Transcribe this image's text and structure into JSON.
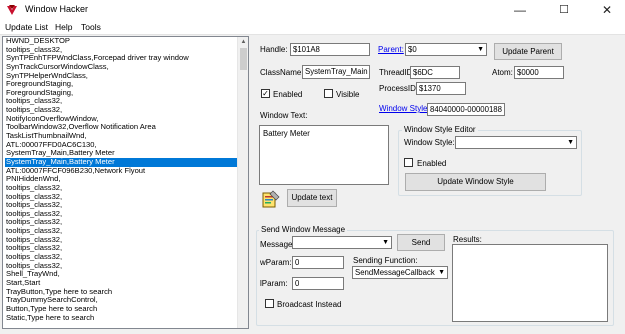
{
  "window": {
    "title": "Window Hacker",
    "minimize": "—",
    "maximize": "☐",
    "close": "✕"
  },
  "menu": {
    "items": [
      "Update List",
      "Help",
      "Tools"
    ]
  },
  "window_list": {
    "selected_index": 14,
    "items": [
      "HWND_DESKTOP",
      "tooltips_class32,",
      "SynTPEnhTFPWndClass,Forcepad driver tray window",
      "SynTrackCursorWindowClass,",
      "SynTPHelperWndClass,",
      "ForegroundStaging,",
      "ForegroundStaging,",
      "tooltips_class32,",
      "tooltips_class32,",
      "NotifyIconOverflowWindow,",
      "ToolbarWindow32,Overflow Notification Area",
      "TaskListThumbnailWnd,",
      "ATL:00007FFD0AC6C130,",
      "SystemTray_Main,Battery Meter",
      "SystemTray_Main,Battery Meter",
      "ATL:00007FFCF096B230,Network Flyout",
      "PNIHiddenWnd,",
      "tooltips_class32,",
      "tooltips_class32,",
      "tooltips_class32,",
      "tooltips_class32,",
      "tooltips_class32,",
      "tooltips_class32,",
      "tooltips_class32,",
      "tooltips_class32,",
      "tooltips_class32,",
      "tooltips_class32,",
      "Shell_TrayWnd,",
      "Start,Start",
      "TrayButton,Type here to search",
      "TrayDummySearchControl,",
      "Button,Type here to search",
      "Static,Type here to search"
    ]
  },
  "props": {
    "handle_label": "Handle:",
    "handle_value": "$101A8",
    "parent_label": "Parent:",
    "parent_value": "$0",
    "update_parent": "Update Parent",
    "classname_label": "ClassName:",
    "classname_value": "SystemTray_Main",
    "threadid_label": "ThreadID:",
    "threadid_value": "$6DC",
    "atom_label": "Atom:",
    "atom_value": "$0000",
    "processid_label": "ProcessID:",
    "processid_value": "$1370",
    "enabled_label": "Enabled",
    "visible_label": "Visible",
    "windowtext_label": "Window Text:",
    "windowtext_value": "Battery Meter",
    "windowstyle_label": "Window Style:",
    "windowstyle_value": "84040000-00000188",
    "update_text": "Update text"
  },
  "style_editor": {
    "title": "Window Style Editor",
    "style_label": "Window Style:",
    "style_value": "",
    "enabled_label": "Enabled",
    "update_button": "Update Window Style"
  },
  "send_message": {
    "title": "Send Window Message",
    "message_label": "Message",
    "message_value": "",
    "send_button": "Send",
    "results_label": "Results:",
    "wparam_label": "wParam:",
    "wparam_value": "0",
    "lparam_label": "lParam:",
    "lparam_value": "0",
    "sending_function_label": "Sending Function:",
    "sending_function_value": "SendMessageCallback",
    "broadcast_label": "Broadcast Instead"
  },
  "state": {
    "enabled_checked": true,
    "visible_checked": false,
    "editor_enabled_checked": false,
    "broadcast_checked": false
  },
  "colors": {
    "selection": "#0078d7",
    "link": "#0000ee",
    "default_button_border": "#0078d7"
  },
  "icons": {
    "app": "app-logo-icon",
    "update_text": "edit-text-icon"
  }
}
